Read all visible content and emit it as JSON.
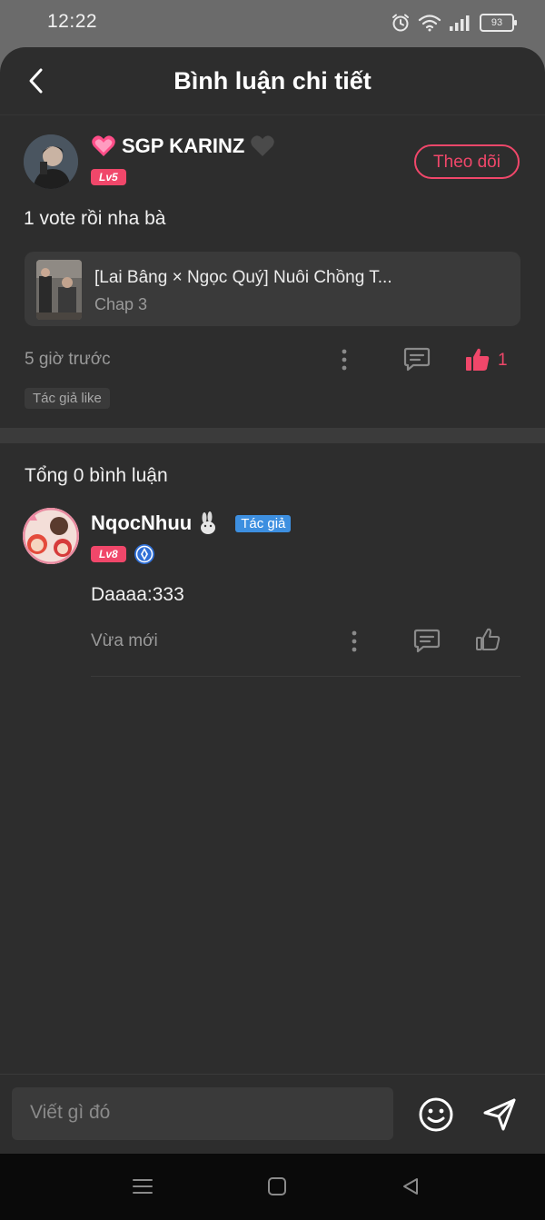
{
  "status_bar": {
    "time": "12:22",
    "battery": "93"
  },
  "header": {
    "title": "Bình luận chi tiết"
  },
  "comment": {
    "username": "SGP KARINZ",
    "level": "Lv5",
    "follow_label": "Theo dõi",
    "text": "1 vote rồi nha bà",
    "chapter_title": "[Lai Bâng × Ngọc Quý] Nuôi Chồng T...",
    "chapter_sub": "Chap 3",
    "time": "5 giờ trước",
    "like_count": "1",
    "tag": "Tác giả like"
  },
  "replies": {
    "total_label": "Tổng 0 bình luận",
    "items": [
      {
        "username": "NqocNhuu",
        "author_badge": "Tác giả",
        "level": "Lv8",
        "text": "Daaaa:333",
        "time": "Vừa mới"
      }
    ]
  },
  "input": {
    "placeholder": "Viết gì đó"
  },
  "colors": {
    "accent": "#f0476a",
    "author_badge": "#3d8fe0",
    "background": "#2d2d2d"
  }
}
